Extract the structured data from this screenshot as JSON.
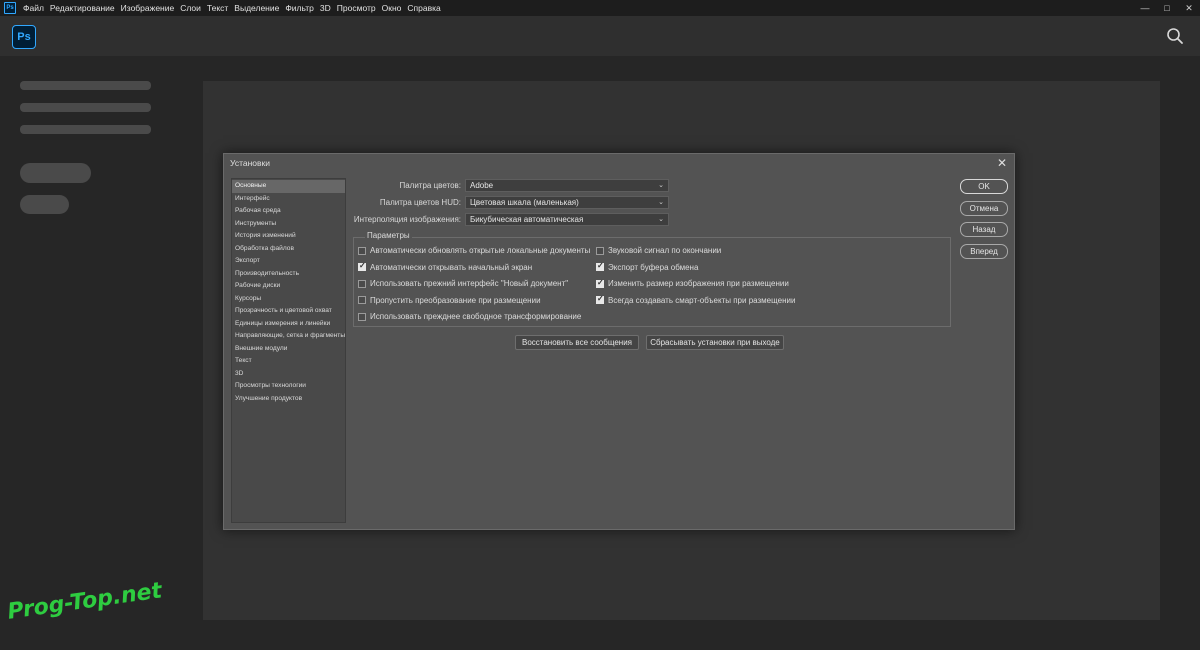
{
  "menubar": {
    "app_badge": "Ps",
    "items": [
      "Файл",
      "Редактирование",
      "Изображение",
      "Слои",
      "Текст",
      "Выделение",
      "Фильтр",
      "3D",
      "Просмотр",
      "Окно",
      "Справка"
    ],
    "controls": [
      "—",
      "□",
      "✕"
    ]
  },
  "appbar": {
    "logo": "Ps",
    "search_icon": "search-icon"
  },
  "watermark": "Prog-Top.net",
  "dialog": {
    "title": "Установки",
    "categories": [
      "Основные",
      "Интерфейс",
      "Рабочая среда",
      "Инструменты",
      "История изменений",
      "Обработка файлов",
      "Экспорт",
      "Производительность",
      "Рабочие диски",
      "Курсоры",
      "Прозрачность и цветовой охват",
      "Единицы измерения и линейки",
      "Направляющие, сетка и фрагменты",
      "Внешние модули",
      "Текст",
      "3D",
      "Просмотры технологии",
      "Улучшение продуктов"
    ],
    "selected_category": 0,
    "fields": {
      "color_picker_label": "Палитра цветов:",
      "color_picker_value": "Adobe",
      "hud_picker_label": "Палитра цветов HUD:",
      "hud_picker_value": "Цветовая шкала (маленькая)",
      "interpolation_label": "Интерполяция изображения:",
      "interpolation_value": "Бикубическая автоматическая"
    },
    "params_title": "Параметры",
    "options_left": [
      {
        "label": "Автоматически обновлять открытые локальные документы",
        "checked": false
      },
      {
        "label": "Автоматически открывать начальный экран",
        "checked": true
      },
      {
        "label": "Использовать прежний интерфейс \"Новый документ\"",
        "checked": false
      },
      {
        "label": "Пропустить преобразование при размещении",
        "checked": false
      },
      {
        "label": "Использовать прежднее свободное трансформирование",
        "checked": false
      }
    ],
    "options_right": [
      {
        "label": "Звуковой сигнал по окончании",
        "checked": false
      },
      {
        "label": "Экспорт буфера обмена",
        "checked": true
      },
      {
        "label": "Изменить размер изображения при размещении",
        "checked": true
      },
      {
        "label": "Всегда создавать смарт-объекты при размещении",
        "checked": true
      }
    ],
    "buttons": {
      "reset_messages": "Восстановить все сообщения",
      "reset_on_exit": "Сбрасывать установки при выходе",
      "ok": "OK",
      "cancel": "Отмена",
      "back": "Назад",
      "forward": "Вперед"
    }
  }
}
